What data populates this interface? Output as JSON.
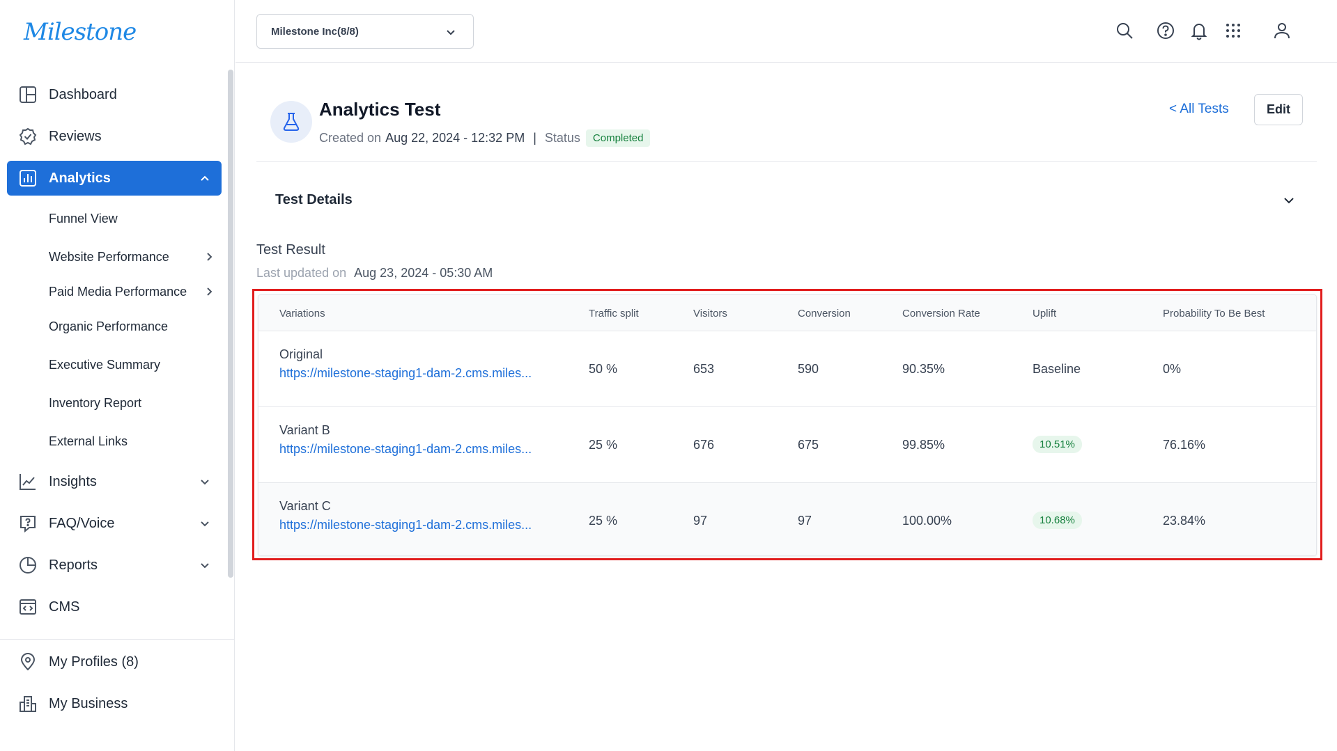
{
  "brand": {
    "logo_text": "Milestone",
    "accent": "#1e6fd9",
    "logo_color": "#1e88e5"
  },
  "sidebar": {
    "items": [
      {
        "label": "Dashboard",
        "icon": "dashboard-icon"
      },
      {
        "label": "Reviews",
        "icon": "reviews-icon"
      },
      {
        "label": "Analytics",
        "icon": "analytics-icon",
        "active": true,
        "expanded": true
      },
      {
        "label": "Insights",
        "icon": "insights-icon"
      },
      {
        "label": "FAQ/Voice",
        "icon": "faq-icon"
      },
      {
        "label": "Reports",
        "icon": "reports-icon"
      },
      {
        "label": "CMS",
        "icon": "cms-icon"
      },
      {
        "label": "My Profiles (8)",
        "icon": "location-pin-icon"
      },
      {
        "label": "My Business",
        "icon": "business-icon"
      }
    ],
    "analytics_subitems": [
      {
        "label": "Funnel View"
      },
      {
        "label": "Website Performance"
      },
      {
        "label": "Paid Media Performance"
      },
      {
        "label": "Organic Performance"
      },
      {
        "label": "Executive Summary"
      },
      {
        "label": "Inventory Report"
      },
      {
        "label": "External Links"
      }
    ]
  },
  "header": {
    "org_selector": "Milestone Inc(8/8)",
    "icons": [
      "search-icon",
      "help-icon",
      "bell-icon",
      "apps-grid-icon",
      "user-icon"
    ]
  },
  "test": {
    "title": "Analytics Test",
    "created_label": "Created on",
    "created_value": "Aug 22, 2024 - 12:32 PM",
    "status_label": "Status",
    "status_value": "Completed",
    "all_tests_link": "< All Tests",
    "edit_label": "Edit"
  },
  "details": {
    "title": "Test Details"
  },
  "result": {
    "title": "Test Result",
    "updated_label": "Last updated on",
    "updated_value": "Aug 23, 2024 - 05:30 AM",
    "columns": [
      "Variations",
      "Traffic split",
      "Visitors",
      "Conversion",
      "Conversion Rate",
      "Uplift",
      "Probability To Be Best"
    ],
    "rows": [
      {
        "name": "Original",
        "url": "https://milestone-staging1-dam-2.cms.miles...",
        "traffic": "50 %",
        "visitors": "653",
        "conversion": "590",
        "rate": "90.35%",
        "uplift": "Baseline",
        "probability": "0%"
      },
      {
        "name": "Variant B",
        "url": "https://milestone-staging1-dam-2.cms.miles...",
        "traffic": "25 %",
        "visitors": "676",
        "conversion": "675",
        "rate": "99.85%",
        "uplift": "10.51%",
        "probability": "76.16%"
      },
      {
        "name": "Variant C",
        "url": "https://milestone-staging1-dam-2.cms.miles...",
        "traffic": "25 %",
        "visitors": "97",
        "conversion": "97",
        "rate": "100.00%",
        "uplift": "10.68%",
        "probability": "23.84%"
      }
    ]
  }
}
